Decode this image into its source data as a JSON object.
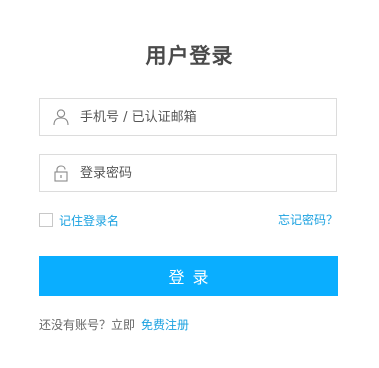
{
  "form": {
    "title": "用户登录",
    "username_placeholder": "手机号 / 已认证邮箱",
    "password_placeholder": "登录密码",
    "remember_label": "记住登录名",
    "forgot_label": "忘记密码？",
    "login_label": "登录",
    "no_account_text": "还没有账号？立即",
    "register_label": "免费注册"
  },
  "colors": {
    "accent": "#0aaeff",
    "link": "#1aa1e0",
    "border": "#dcdcdc"
  },
  "icons": {
    "username": "user-icon",
    "password": "lock-icon"
  }
}
